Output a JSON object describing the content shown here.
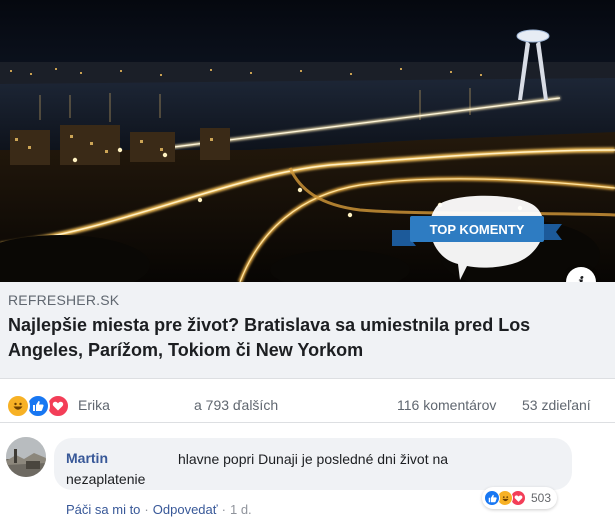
{
  "hero": {
    "badge_label": "TOP KOMENTY"
  },
  "link": {
    "domain": "REFRESHER.SK",
    "headline": "Najlepšie miesta pre život? Bratislava sa umiestnila pred Los Angeles, Parížom, Tokiom či New Yorkom",
    "info_glyph": "i"
  },
  "stats": {
    "reactions": [
      "haha",
      "like",
      "love"
    ],
    "reactor_name": "Erika",
    "others": "a 793 ďalších",
    "comments": "116 komentárov",
    "shares": "53 zdieľaní"
  },
  "comment": {
    "author": "Martin",
    "text_line1": "hlavne popri Dunaji je posledné dni život na",
    "text_line2": "nezaplatenie",
    "reactions": [
      "like",
      "haha",
      "love"
    ],
    "reaction_count": "503",
    "like_label": "Páči sa mi to",
    "reply_label": "Odpovedať",
    "separator": "·",
    "time": "1 d."
  },
  "colors": {
    "link_blue": "#385898",
    "like_blue": "#1877f2",
    "love_red": "#f33e58",
    "haha_yellow": "#f7b125",
    "badge_blue": "#2e7cc2"
  }
}
